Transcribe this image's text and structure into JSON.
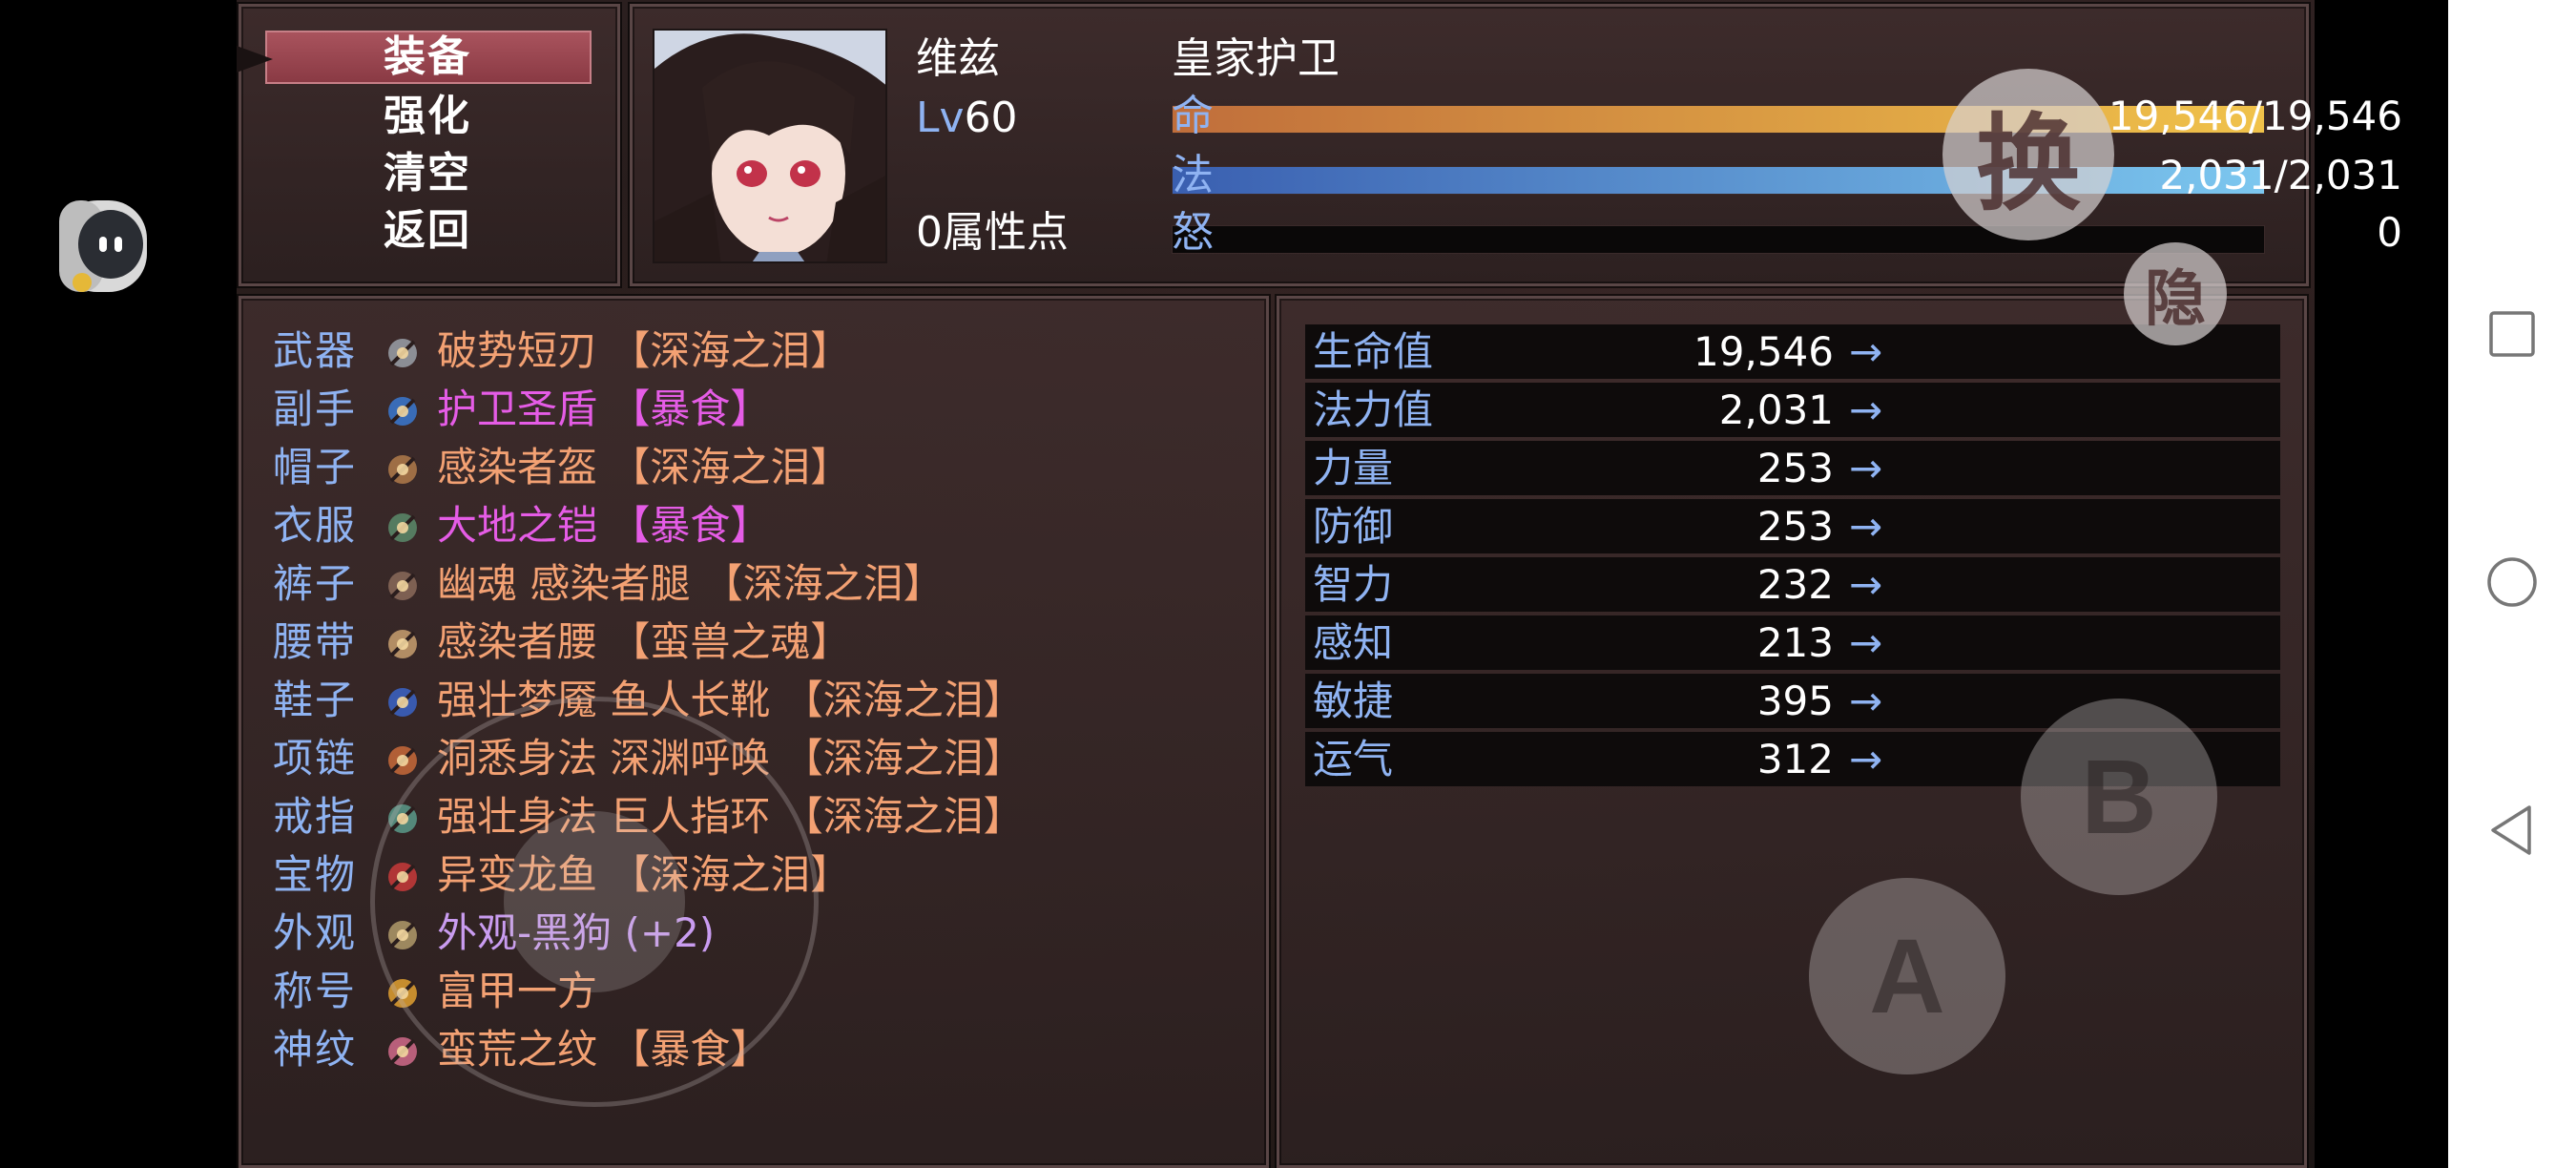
{
  "menu": {
    "items": [
      "装备",
      "强化",
      "清空",
      "返回"
    ],
    "selected_index": 0
  },
  "character": {
    "name": "维兹",
    "title": "皇家护卫",
    "level_prefix": "Lv",
    "level": "60",
    "attribute_points": "0属性点"
  },
  "bars": [
    {
      "label": "命",
      "value": "19,546/19,546",
      "fill": 1.0,
      "colors": [
        "#c06e3b",
        "#f0c24a"
      ]
    },
    {
      "label": "法",
      "value": "2,031/2,031",
      "fill": 1.0,
      "colors": [
        "#3a5fb0",
        "#7cc7ef"
      ]
    },
    {
      "label": "怒",
      "value": "0",
      "fill": 0.0,
      "colors": [
        "#7a2a2a",
        "#c04040"
      ]
    }
  ],
  "equipment": [
    {
      "slot": "武器",
      "item": "破势短刃 【深海之泪】",
      "color": "#f3a173",
      "icon": "dagger-icon"
    },
    {
      "slot": "副手",
      "item": "护卫圣盾 【暴食】",
      "color": "#e55ce6",
      "icon": "shield-icon"
    },
    {
      "slot": "帽子",
      "item": "感染者盔 【深海之泪】",
      "color": "#f3a173",
      "icon": "helmet-icon"
    },
    {
      "slot": "衣服",
      "item": "大地之铠 【暴食】",
      "color": "#e55ce6",
      "icon": "armor-icon"
    },
    {
      "slot": "裤子",
      "item": "幽魂 感染者腿 【深海之泪】",
      "color": "#f3a173",
      "icon": "legs-icon"
    },
    {
      "slot": "腰带",
      "item": "感染者腰 【蛮兽之魂】",
      "color": "#f3a173",
      "icon": "belt-icon"
    },
    {
      "slot": "鞋子",
      "item": "强壮梦魇 鱼人长靴 【深海之泪】",
      "color": "#f3a173",
      "icon": "boots-icon"
    },
    {
      "slot": "项链",
      "item": "洞悉身法 深渊呼唤 【深海之泪】",
      "color": "#f3a173",
      "icon": "necklace-icon"
    },
    {
      "slot": "戒指",
      "item": "强壮身法 巨人指环 【深海之泪】",
      "color": "#f3a173",
      "icon": "ring-icon"
    },
    {
      "slot": "宝物",
      "item": "异变龙鱼 【深海之泪】",
      "color": "#f3a173",
      "icon": "treasure-icon"
    },
    {
      "slot": "外观",
      "item": "外观-黑狗 (+2)",
      "color": "#c99cf0",
      "icon": "costume-icon"
    },
    {
      "slot": "称号",
      "item": "富甲一方",
      "color": "#f3a173",
      "icon": "title-badge-icon"
    },
    {
      "slot": "神纹",
      "item": "蛮荒之纹 【暴食】",
      "color": "#f3a173",
      "icon": "rune-icon"
    }
  ],
  "stats": [
    {
      "label": "生命值",
      "value": "19,546",
      "arrow": "→"
    },
    {
      "label": "法力值",
      "value": "2,031",
      "arrow": "→"
    },
    {
      "label": "力量",
      "value": "253",
      "arrow": "→"
    },
    {
      "label": "防御",
      "value": "253",
      "arrow": "→"
    },
    {
      "label": "智力",
      "value": "232",
      "arrow": "→"
    },
    {
      "label": "感知",
      "value": "213",
      "arrow": "→"
    },
    {
      "label": "敏捷",
      "value": "395",
      "arrow": "→"
    },
    {
      "label": "运气",
      "value": "312",
      "arrow": "→"
    }
  ],
  "overlay_buttons": {
    "swap": "换",
    "hide": "隐",
    "b": "B",
    "a": "A"
  },
  "icons": {
    "assistant": "assistant-bot-icon",
    "nav_recent": "square-icon",
    "nav_home": "circle-icon",
    "nav_back": "triangle-back-icon"
  }
}
